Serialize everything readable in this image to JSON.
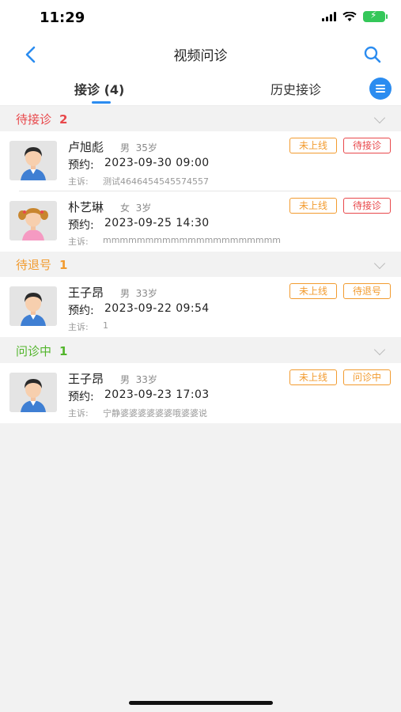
{
  "status_bar": {
    "time": "11:29"
  },
  "nav": {
    "title": "视频问诊"
  },
  "tabs": {
    "active": "接诊 (4)",
    "history": "历史接诊"
  },
  "colors": {
    "accent": "#2b8cf0",
    "waiting": "#e8484b",
    "pending_refund": "#f29b2f",
    "in_consult": "#52b52b"
  },
  "sections": [
    {
      "label": "待接诊",
      "count": "2",
      "patients": [
        {
          "name": "卢旭彪",
          "gender": "男",
          "age": "35岁",
          "appt_label": "预约:",
          "appt_time": "2023-09-30 09:00",
          "complaint_label": "主诉:",
          "complaint": "测试4646454545574557",
          "offline_tag": "未上线",
          "status_tag": "待接诊",
          "avatar": "male-avatar-icon"
        },
        {
          "name": "朴艺琳",
          "gender": "女",
          "age": "3岁",
          "appt_label": "预约:",
          "appt_time": "2023-09-25 14:30",
          "complaint_label": "主诉:",
          "complaint": "mmmmmmmmmmmmmmmmmmmmm",
          "offline_tag": "未上线",
          "status_tag": "待接诊",
          "avatar": "girl-avatar-icon"
        }
      ]
    },
    {
      "label": "待退号",
      "count": "1",
      "patients": [
        {
          "name": "王子昂",
          "gender": "男",
          "age": "33岁",
          "appt_label": "预约:",
          "appt_time": "2023-09-22 09:54",
          "complaint_label": "主诉:",
          "complaint": "1",
          "offline_tag": "未上线",
          "status_tag": "待退号",
          "avatar": "male-avatar-icon"
        }
      ]
    },
    {
      "label": "问诊中",
      "count": "1",
      "patients": [
        {
          "name": "王子昂",
          "gender": "男",
          "age": "33岁",
          "appt_label": "预约:",
          "appt_time": "2023-09-23 17:03",
          "complaint_label": "主诉:",
          "complaint": "宁静婆婆婆婆婆婆哦婆婆说",
          "offline_tag": "未上线",
          "status_tag": "问诊中",
          "avatar": "male-avatar-icon"
        }
      ]
    }
  ]
}
